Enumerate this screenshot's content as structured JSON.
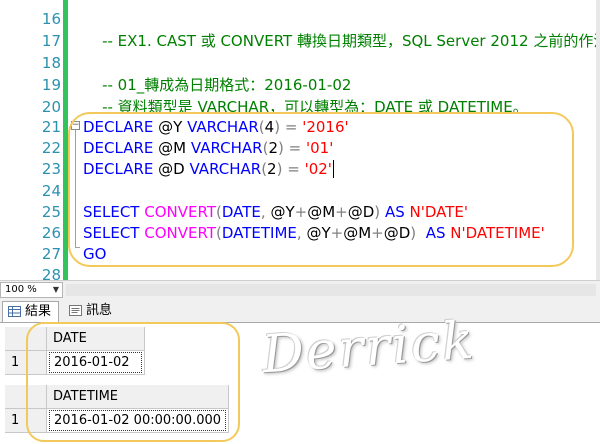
{
  "editor": {
    "lines": [
      {
        "num": "16",
        "comment": "-- EX1. CAST 或 CONVERT 轉換日期類型，SQL Server 2012 之前的作法"
      },
      {
        "num": "17"
      },
      {
        "num": "18",
        "comment": "-- 01_轉成為日期格式：2016-01-02"
      },
      {
        "num": "19",
        "comment": "-- 資料類型是 VARCHAR，可以轉型為：DATE 或 DATETIME。"
      },
      {
        "num": "20"
      },
      {
        "num": "21",
        "kw1": "DECLARE",
        "var": "@Y",
        "kw2": "VARCHAR",
        "p1": "(",
        "n": "4",
        "p2": ")",
        "eq": "=",
        "str": "'2016'"
      },
      {
        "num": "22",
        "kw1": "DECLARE",
        "var": "@M",
        "kw2": "VARCHAR",
        "p1": "(",
        "n": "2",
        "p2": ")",
        "eq": "=",
        "str": "'01'"
      },
      {
        "num": "23",
        "kw1": "DECLARE",
        "var": "@D",
        "kw2": "VARCHAR",
        "p1": "(",
        "n": "2",
        "p2": ")",
        "eq": "=",
        "str": "'02'"
      },
      {
        "num": "24"
      },
      {
        "num": "25",
        "kw1": "SELECT",
        "fn": "CONVERT",
        "p1": "(",
        "kw2": "DATE",
        "comma": ",",
        "v1": "@Y",
        "plus1": "+",
        "v2": "@M",
        "plus2": "+",
        "v3": "@D",
        "p2": ")",
        "as": "AS",
        "str": "N'DATE'"
      },
      {
        "num": "26",
        "kw1": "SELECT",
        "fn": "CONVERT",
        "p1": "(",
        "kw2": "DATETIME",
        "comma": ",",
        "v1": "@Y",
        "plus1": "+",
        "v2": "@M",
        "plus2": "+",
        "v3": "@D",
        "p2": ")",
        "as": "AS",
        "str": "N'DATETIME'"
      },
      {
        "num": "27",
        "kw1": "GO"
      },
      {
        "num": "28"
      }
    ]
  },
  "zoom": {
    "value": "100 %"
  },
  "tabs": {
    "results": "結果",
    "messages": "訊息"
  },
  "grids": [
    {
      "column": "DATE",
      "row_num": "1",
      "value": "2016-01-02"
    },
    {
      "column": "DATETIME",
      "row_num": "1",
      "value": "2016-01-02 00:00:00.000"
    }
  ],
  "watermark": "Derrick",
  "colors": {
    "comment": "#008000",
    "keyword": "#0000ff",
    "function": "#ff00ff",
    "string": "#ff0000",
    "operator": "#808080",
    "line_number": "#2b91af",
    "change_bar": "#31c45a",
    "highlight": "#f2c95a"
  }
}
